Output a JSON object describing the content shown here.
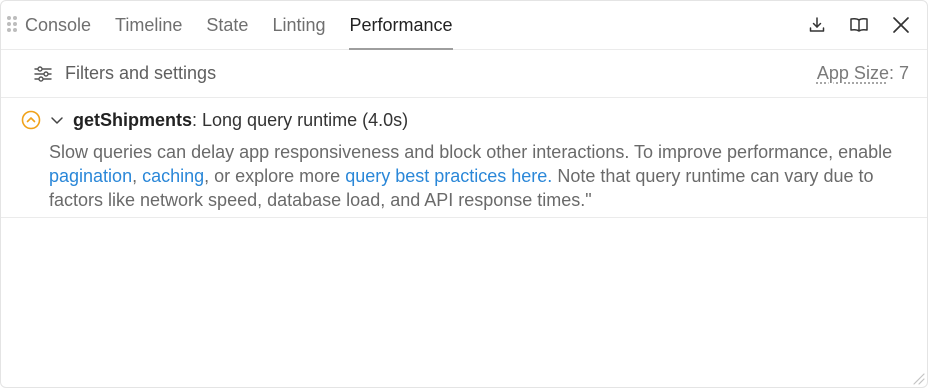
{
  "tabs": [
    {
      "label": "Console",
      "active": false
    },
    {
      "label": "Timeline",
      "active": false
    },
    {
      "label": "State",
      "active": false
    },
    {
      "label": "Linting",
      "active": false
    },
    {
      "label": "Performance",
      "active": true
    }
  ],
  "tab_actions": {
    "download_icon": "download-icon",
    "docs_icon": "book-icon",
    "close_icon": "close-icon"
  },
  "filters": {
    "label": "Filters and settings",
    "icon": "sliders-icon",
    "app_size_label": "App Size",
    "app_size_separator": ":",
    "app_size_value": "7"
  },
  "warning": {
    "status_icon": "chevron-up-circle-icon",
    "status_color": "#f0a21a",
    "toggle_icon": "chevron-down-icon",
    "query_name": "getShipments",
    "title_rest": ": Long query runtime (4.0s)",
    "body_1": "Slow queries can delay app responsiveness and block other interactions. To improve performance, enable ",
    "link_pagination": "pagination",
    "sep_1": ", ",
    "link_caching": "caching",
    "body_2": ", or explore more ",
    "link_best_practices": "query best practices here.",
    "body_3": " Note that query runtime can vary due to factors like network speed, database load, and API response times.\""
  },
  "colors": {
    "link": "#2a87d8",
    "warning": "#f0a21a"
  }
}
